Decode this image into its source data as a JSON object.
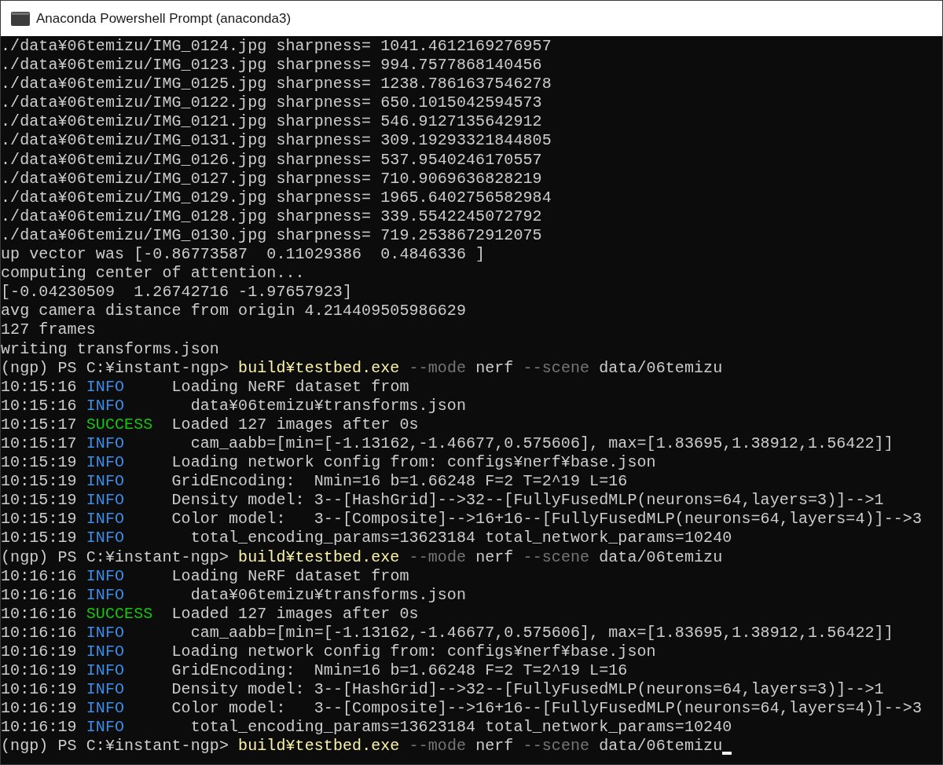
{
  "window": {
    "title": "Anaconda Powershell Prompt (anaconda3)"
  },
  "lines": [
    [
      {
        "kind": "plain",
        "text": "./data¥06temizu/IMG_0124.jpg sharpness= 1041.4612169276957"
      }
    ],
    [
      {
        "kind": "plain",
        "text": "./data¥06temizu/IMG_0123.jpg sharpness= 994.7577868140456"
      }
    ],
    [
      {
        "kind": "plain",
        "text": "./data¥06temizu/IMG_0125.jpg sharpness= 1238.7861637546278"
      }
    ],
    [
      {
        "kind": "plain",
        "text": "./data¥06temizu/IMG_0122.jpg sharpness= 650.1015042594573"
      }
    ],
    [
      {
        "kind": "plain",
        "text": "./data¥06temizu/IMG_0121.jpg sharpness= 546.9127135642912"
      }
    ],
    [
      {
        "kind": "plain",
        "text": "./data¥06temizu/IMG_0131.jpg sharpness= 309.19293321844805"
      }
    ],
    [
      {
        "kind": "plain",
        "text": "./data¥06temizu/IMG_0126.jpg sharpness= 537.9540246170557"
      }
    ],
    [
      {
        "kind": "plain",
        "text": "./data¥06temizu/IMG_0127.jpg sharpness= 710.9069636828219"
      }
    ],
    [
      {
        "kind": "plain",
        "text": "./data¥06temizu/IMG_0129.jpg sharpness= 1965.6402756582984"
      }
    ],
    [
      {
        "kind": "plain",
        "text": "./data¥06temizu/IMG_0128.jpg sharpness= 339.5542245072792"
      }
    ],
    [
      {
        "kind": "plain",
        "text": "./data¥06temizu/IMG_0130.jpg sharpness= 719.2538672912075"
      }
    ],
    [
      {
        "kind": "plain",
        "text": "up vector was [-0.86773587  0.11029386  0.4846336 ]"
      }
    ],
    [
      {
        "kind": "plain",
        "text": "computing center of attention..."
      }
    ],
    [
      {
        "kind": "plain",
        "text": "[-0.04230509  1.26742716 -1.97657923]"
      }
    ],
    [
      {
        "kind": "plain",
        "text": "avg camera distance from origin 4.214409505986629"
      }
    ],
    [
      {
        "kind": "plain",
        "text": "127 frames"
      }
    ],
    [
      {
        "kind": "plain",
        "text": "writing transforms.json"
      }
    ],
    [
      {
        "kind": "plain",
        "text": "(ngp) PS C:¥instant-ngp> "
      },
      {
        "kind": "command",
        "text": "build¥testbed.exe"
      },
      {
        "kind": "flag",
        "text": " --mode"
      },
      {
        "kind": "plain",
        "text": " nerf"
      },
      {
        "kind": "flag",
        "text": " --scene"
      },
      {
        "kind": "plain",
        "text": " data/06temizu"
      }
    ],
    [
      {
        "kind": "time",
        "text": "10:15:16 "
      },
      {
        "kind": "info",
        "text": "INFO     "
      },
      {
        "kind": "plain",
        "text": "Loading NeRF dataset from"
      }
    ],
    [
      {
        "kind": "time",
        "text": "10:15:16 "
      },
      {
        "kind": "info",
        "text": "INFO       "
      },
      {
        "kind": "plain",
        "text": "data¥06temizu¥transforms.json"
      }
    ],
    [
      {
        "kind": "time",
        "text": "10:15:17 "
      },
      {
        "kind": "success",
        "text": "SUCCESS  "
      },
      {
        "kind": "plain",
        "text": "Loaded 127 images after 0s"
      }
    ],
    [
      {
        "kind": "time",
        "text": "10:15:17 "
      },
      {
        "kind": "info",
        "text": "INFO       "
      },
      {
        "kind": "plain",
        "text": "cam_aabb=[min=[-1.13162,-1.46677,0.575606], max=[1.83695,1.38912,1.56422]]"
      }
    ],
    [
      {
        "kind": "time",
        "text": "10:15:19 "
      },
      {
        "kind": "info",
        "text": "INFO     "
      },
      {
        "kind": "plain",
        "text": "Loading network config from: configs¥nerf¥base.json"
      }
    ],
    [
      {
        "kind": "time",
        "text": "10:15:19 "
      },
      {
        "kind": "info",
        "text": "INFO     "
      },
      {
        "kind": "plain",
        "text": "GridEncoding:  Nmin=16 b=1.66248 F=2 T=2^19 L=16"
      }
    ],
    [
      {
        "kind": "time",
        "text": "10:15:19 "
      },
      {
        "kind": "info",
        "text": "INFO     "
      },
      {
        "kind": "plain",
        "text": "Density model: 3--[HashGrid]-->32--[FullyFusedMLP(neurons=64,layers=3)]-->1"
      }
    ],
    [
      {
        "kind": "time",
        "text": "10:15:19 "
      },
      {
        "kind": "info",
        "text": "INFO     "
      },
      {
        "kind": "plain",
        "text": "Color model:   3--[Composite]-->16+16--[FullyFusedMLP(neurons=64,layers=4)]-->3"
      }
    ],
    [
      {
        "kind": "time",
        "text": "10:15:19 "
      },
      {
        "kind": "info",
        "text": "INFO       "
      },
      {
        "kind": "plain",
        "text": "total_encoding_params=13623184 total_network_params=10240"
      }
    ],
    [
      {
        "kind": "plain",
        "text": "(ngp) PS C:¥instant-ngp> "
      },
      {
        "kind": "command",
        "text": "build¥testbed.exe"
      },
      {
        "kind": "flag",
        "text": " --mode"
      },
      {
        "kind": "plain",
        "text": " nerf"
      },
      {
        "kind": "flag",
        "text": " --scene"
      },
      {
        "kind": "plain",
        "text": " data/06temizu"
      }
    ],
    [
      {
        "kind": "time",
        "text": "10:16:16 "
      },
      {
        "kind": "info",
        "text": "INFO     "
      },
      {
        "kind": "plain",
        "text": "Loading NeRF dataset from"
      }
    ],
    [
      {
        "kind": "time",
        "text": "10:16:16 "
      },
      {
        "kind": "info",
        "text": "INFO       "
      },
      {
        "kind": "plain",
        "text": "data¥06temizu¥transforms.json"
      }
    ],
    [
      {
        "kind": "time",
        "text": "10:16:16 "
      },
      {
        "kind": "success",
        "text": "SUCCESS  "
      },
      {
        "kind": "plain",
        "text": "Loaded 127 images after 0s"
      }
    ],
    [
      {
        "kind": "time",
        "text": "10:16:16 "
      },
      {
        "kind": "info",
        "text": "INFO       "
      },
      {
        "kind": "plain",
        "text": "cam_aabb=[min=[-1.13162,-1.46677,0.575606], max=[1.83695,1.38912,1.56422]]"
      }
    ],
    [
      {
        "kind": "time",
        "text": "10:16:19 "
      },
      {
        "kind": "info",
        "text": "INFO     "
      },
      {
        "kind": "plain",
        "text": "Loading network config from: configs¥nerf¥base.json"
      }
    ],
    [
      {
        "kind": "time",
        "text": "10:16:19 "
      },
      {
        "kind": "info",
        "text": "INFO     "
      },
      {
        "kind": "plain",
        "text": "GridEncoding:  Nmin=16 b=1.66248 F=2 T=2^19 L=16"
      }
    ],
    [
      {
        "kind": "time",
        "text": "10:16:19 "
      },
      {
        "kind": "info",
        "text": "INFO     "
      },
      {
        "kind": "plain",
        "text": "Density model: 3--[HashGrid]-->32--[FullyFusedMLP(neurons=64,layers=3)]-->1"
      }
    ],
    [
      {
        "kind": "time",
        "text": "10:16:19 "
      },
      {
        "kind": "info",
        "text": "INFO     "
      },
      {
        "kind": "plain",
        "text": "Color model:   3--[Composite]-->16+16--[FullyFusedMLP(neurons=64,layers=4)]-->3"
      }
    ],
    [
      {
        "kind": "time",
        "text": "10:16:19 "
      },
      {
        "kind": "info",
        "text": "INFO       "
      },
      {
        "kind": "plain",
        "text": "total_encoding_params=13623184 total_network_params=10240"
      }
    ],
    [
      {
        "kind": "plain",
        "text": "(ngp) PS C:¥instant-ngp> "
      },
      {
        "kind": "command",
        "text": "build¥testbed.exe"
      },
      {
        "kind": "flag",
        "text": " --mode"
      },
      {
        "kind": "plain",
        "text": " nerf"
      },
      {
        "kind": "flag",
        "text": " --scene"
      },
      {
        "kind": "plain",
        "text": " data/06temizu"
      }
    ]
  ]
}
